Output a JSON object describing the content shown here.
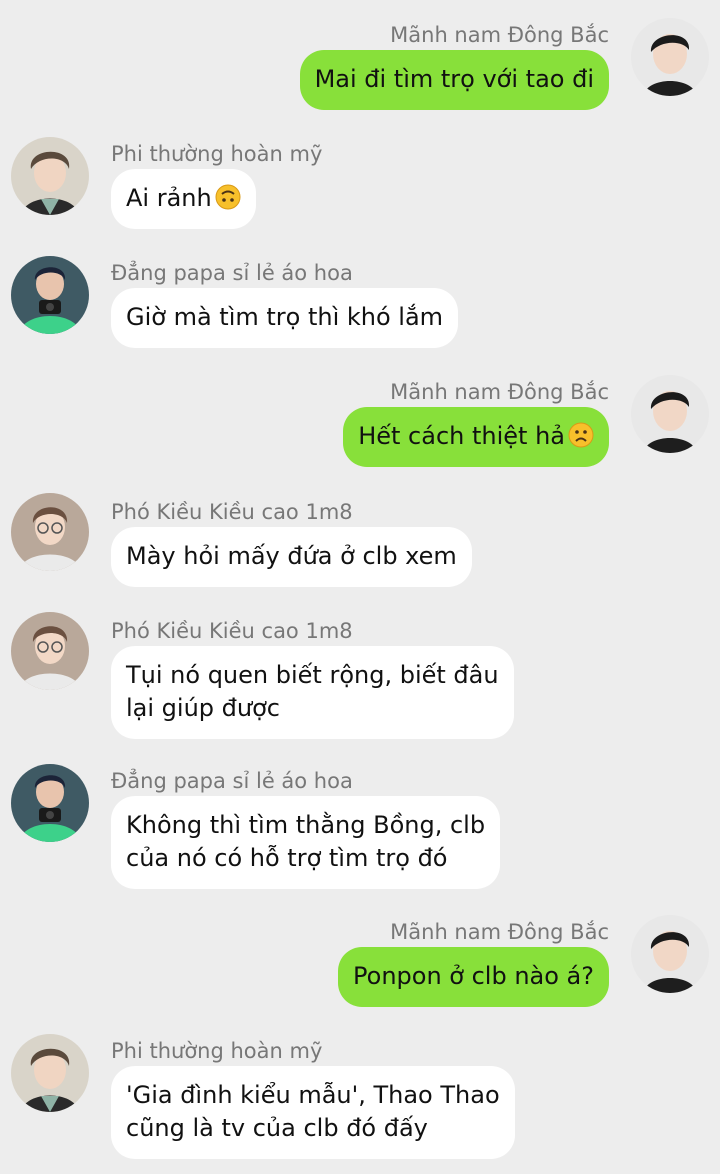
{
  "colors": {
    "background": "#ededed",
    "incoming_bubble": "#ffffff",
    "outgoing_bubble": "#88e03a",
    "sender_text": "#777777"
  },
  "messages": [
    {
      "direction": "out",
      "sender": "Mãnh nam Đông Bắc",
      "text": "Mai đi tìm trọ với tao đi",
      "avatar": "black-hair-man-avatar"
    },
    {
      "direction": "in",
      "sender": "Phi thường hoàn mỹ",
      "text": "Ai rảnh",
      "emoji": "upside-down-face-emoji",
      "avatar": "curly-hair-man-avatar"
    },
    {
      "direction": "in",
      "sender": "Đẳng papa sỉ lẻ áo hoa",
      "text": "Giờ mà tìm trọ thì khó lắm",
      "avatar": "camera-man-avatar"
    },
    {
      "direction": "out",
      "sender": "Mãnh nam Đông Bắc",
      "text": "Hết cách thiệt hả",
      "emoji": "frowning-face-emoji",
      "avatar": "black-hair-man-avatar"
    },
    {
      "direction": "in",
      "sender": "Phó Kiều Kiều cao 1m8",
      "text": "Mày hỏi mấy đứa ở clb xem",
      "avatar": "glasses-man-avatar"
    },
    {
      "direction": "in",
      "sender": "Phó Kiều Kiều cao 1m8",
      "lines": [
        "Tụi nó quen biết rộng, biết đâu",
        "lại giúp được"
      ],
      "avatar": "glasses-man-avatar"
    },
    {
      "direction": "in",
      "sender": "Đẳng papa sỉ lẻ áo hoa",
      "lines": [
        "Không thì tìm thằng Bồng, clb",
        "của nó có hỗ trợ tìm trọ đó"
      ],
      "avatar": "camera-man-avatar"
    },
    {
      "direction": "out",
      "sender": "Mãnh nam Đông Bắc",
      "text": "Ponpon ở clb nào á?",
      "avatar": "black-hair-man-avatar"
    },
    {
      "direction": "in",
      "sender": "Phi thường hoàn mỹ",
      "lines": [
        "'Gia đình kiểu mẫu', Thao Thao",
        "cũng là tv của clb đó đấy"
      ],
      "avatar": "curly-hair-man-avatar"
    }
  ]
}
